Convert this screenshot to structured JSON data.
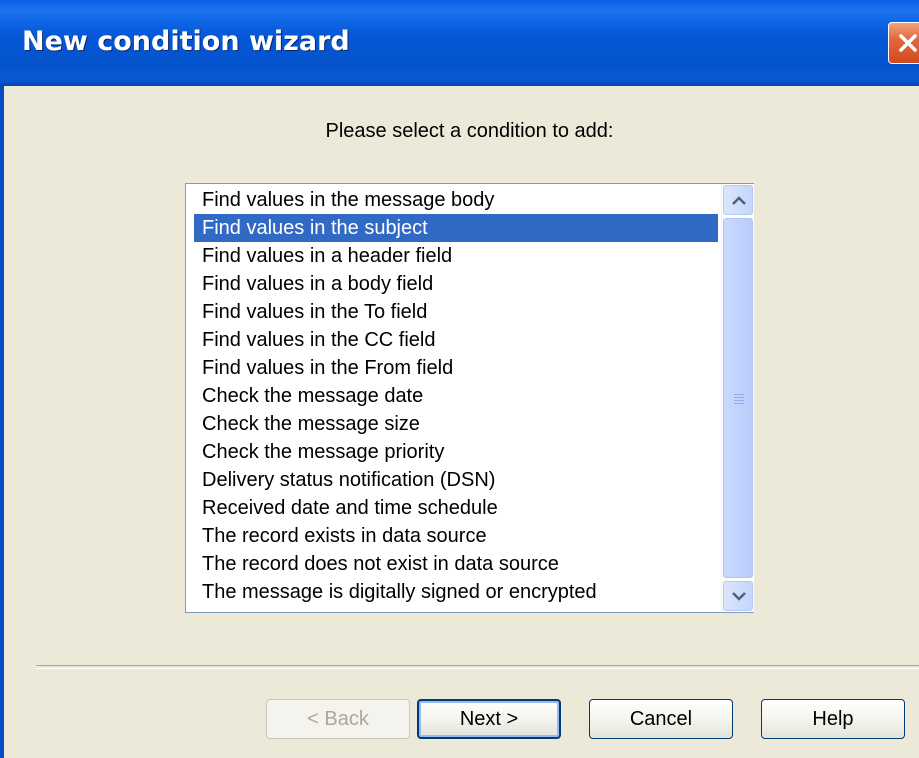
{
  "window": {
    "title": "New condition wizard"
  },
  "prompt": "Please select a condition to add:",
  "conditions": [
    "Find values in the message body",
    "Find values in the subject",
    "Find values in a header field",
    "Find values in a body field",
    "Find values in the To field",
    "Find values in the CC field",
    "Find values in the From field",
    "Check the message date",
    "Check the message size",
    "Check the message priority",
    "Delivery status notification (DSN)",
    "Received date and time schedule",
    "The record exists in data source",
    "The record does not exist in data source",
    "The message is digitally signed or encrypted"
  ],
  "selected_condition": "Find values in the subject",
  "buttons": {
    "back": "< Back",
    "next": "Next >",
    "cancel": "Cancel",
    "help": "Help"
  },
  "icons": {
    "close": "close-icon",
    "scroll_up": "chevron-up-icon",
    "scroll_down": "chevron-down-icon"
  },
  "colors": {
    "titlebar": "#0453cc",
    "selection": "#316ac5",
    "dialog_background": "#ece9d8",
    "close_button": "#e2693d"
  }
}
